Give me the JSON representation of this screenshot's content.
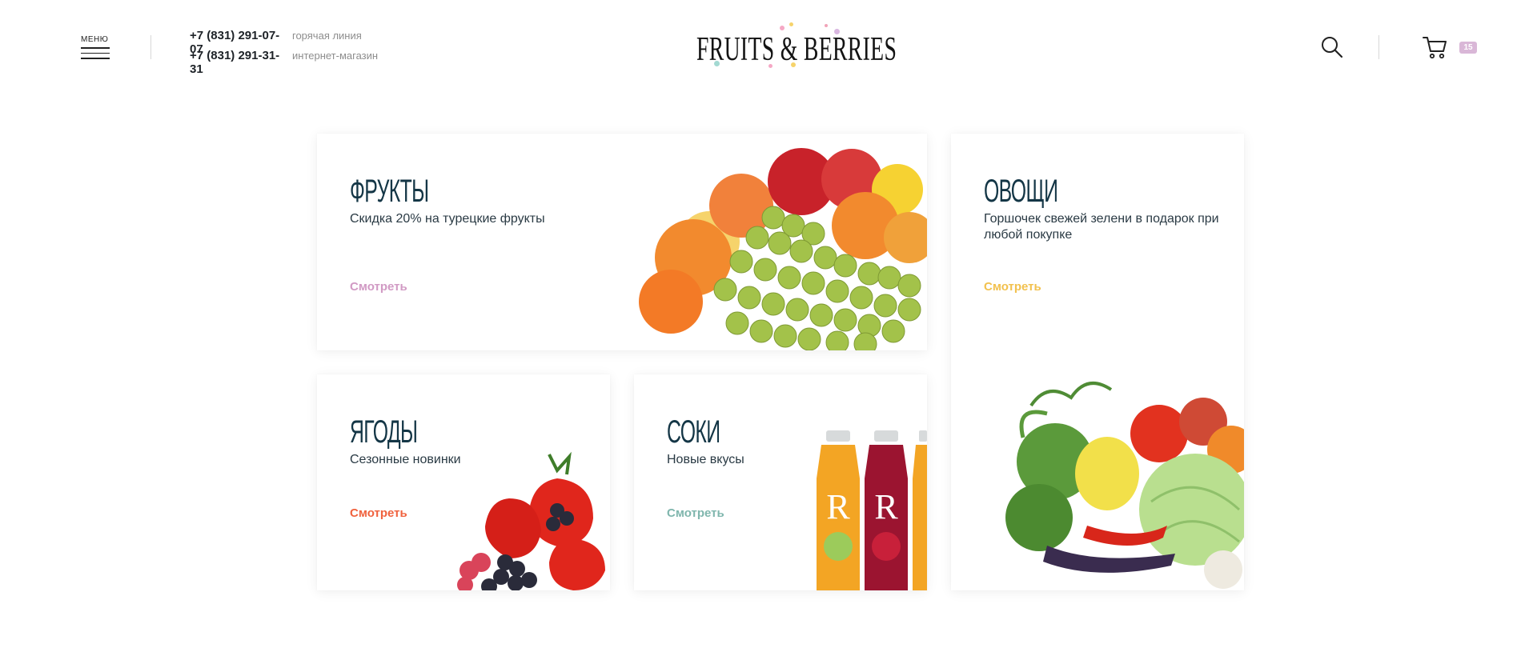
{
  "header": {
    "menu_label": "МЕНЮ",
    "phones": [
      {
        "number": "+7 (831) 291-07-07",
        "note": "горячая линия"
      },
      {
        "number": "+7 (831) 291-31-31",
        "note": "интернет-магазин"
      }
    ],
    "logo_text": "FRUITS & BERRIES",
    "search_icon": "search-icon",
    "cart_icon": "cart-icon",
    "cart_count": "15"
  },
  "categories": [
    {
      "title": "ФРУКТЫ",
      "subtitle": "Скидка 20% на турецкие фрукты",
      "link": "Смотреть",
      "link_color": "#d19ac4"
    },
    {
      "title": "ОВОЩИ",
      "subtitle": "Горшочек свежей зелени в подарок при любой покупке",
      "link": "Смотреть",
      "link_color": "#f2c14e"
    },
    {
      "title": "ЯГОДЫ",
      "subtitle": "Сезонные новинки",
      "link": "Смотреть",
      "link_color": "#f0623e"
    },
    {
      "title": "СОКИ",
      "subtitle": "Новые вкусы",
      "link": "Смотреть",
      "link_color": "#7fb6ad"
    }
  ],
  "colors": {
    "accent_badge": "#d9b7d7",
    "title": "#143646"
  }
}
